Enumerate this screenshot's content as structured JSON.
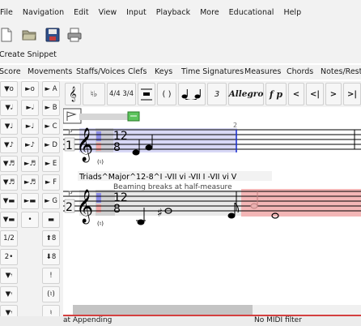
{
  "menu": [
    "File",
    "Navigation",
    "Edit",
    "View",
    "Input",
    "Playback",
    "More",
    "Educational",
    "Help"
  ],
  "toolbar": {
    "icons": [
      "new-file-icon",
      "open-folder-icon",
      "save-disk-icon",
      "print-icon"
    ]
  },
  "snippet_label": "Create Snippet",
  "tabs": [
    "Score",
    "Movements",
    "Staffs/Voices",
    "Clefs",
    "Keys",
    "Time Signatures",
    "Measures",
    "Chords",
    "Notes/Rests"
  ],
  "palette": [
    "4/4 3/4",
    "( )",
    "3",
    "Allegro",
    "f p",
    "<",
    "<|",
    ">",
    ">|"
  ],
  "left_grid": {
    "col1": [
      "▼o",
      "▼𝅗𝅥",
      "▼♩",
      "▼♪",
      "▼♬",
      "▼♬",
      "▼▬",
      "▼▬",
      "1/2",
      "2•",
      "▼𝄾",
      "▼𝄾",
      "▼𝄾",
      "•"
    ],
    "col2": [
      "►o",
      "►𝅗𝅥",
      "►♩",
      "►♪",
      "►♬",
      "►♬",
      "►▬",
      "•",
      "",
      "",
      "",
      "",
      "",
      ""
    ],
    "col3": [
      "► A",
      "► B",
      "► C",
      "► D",
      "► E",
      "► F",
      "► G",
      "▬",
      "⬆8",
      "⬇8",
      "!",
      "(♮)",
      "♮",
      "♭"
    ]
  },
  "score": {
    "time_num": "12",
    "time_den": "8",
    "staff1_number": "1",
    "staff2_number": "2",
    "measure_number": "2",
    "small_paren": "(♮)",
    "small_paren_2": "(♮)",
    "triads_text": "Triads^Major^12-8^I -VII vi -VII I -VII vi V",
    "beaming_text": "Beaming breaks at half-measure",
    "tempo_placeholder": ""
  },
  "status": {
    "left": "at Appending",
    "right": "No MIDI filter"
  },
  "colors": {
    "chrome": "#f2f2f2",
    "selection_blue": "#d8d8f6",
    "selection_red": "#f3b6b6",
    "green_marker": "#5cc45c",
    "red_line": "#d44040"
  }
}
